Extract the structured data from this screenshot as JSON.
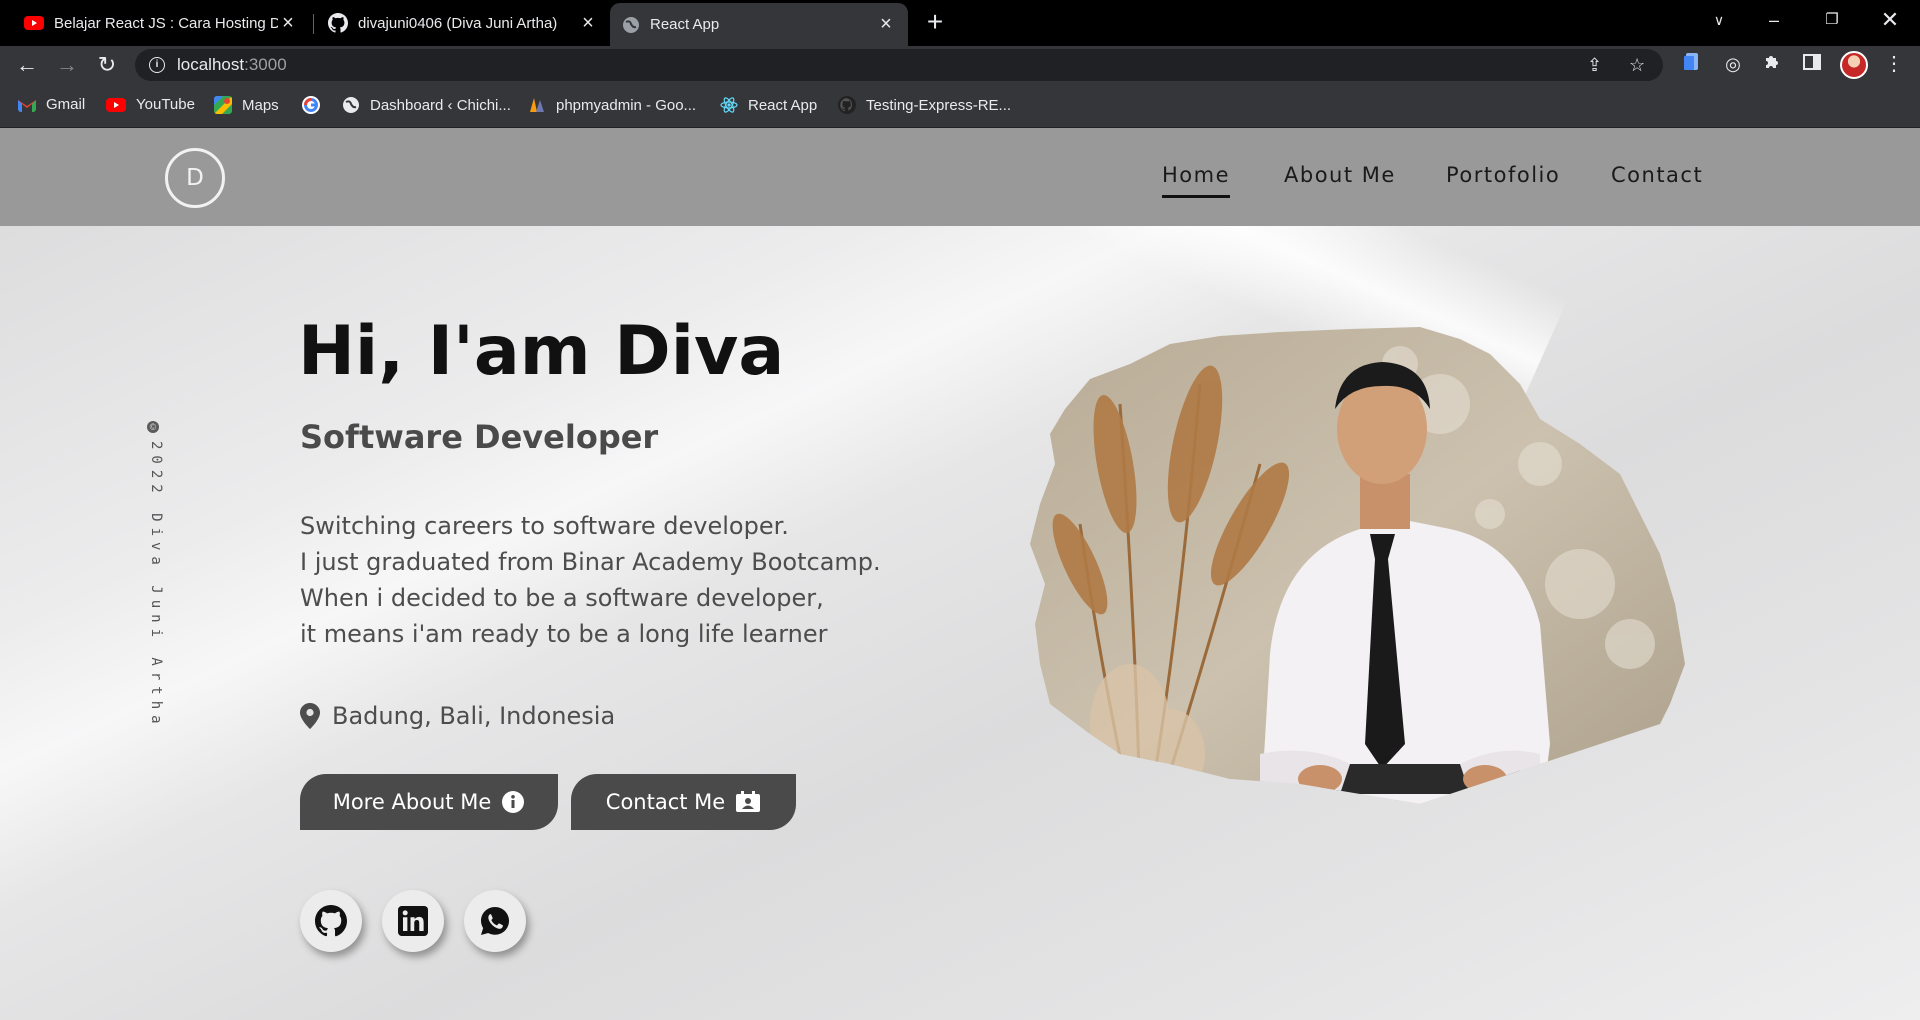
{
  "browser": {
    "tabs": [
      {
        "title": "Belajar React JS : Cara Hosting De",
        "icon": "youtube-icon",
        "active": false
      },
      {
        "title": "divajuni0406 (Diva Juni Artha)",
        "icon": "github-icon",
        "active": false
      },
      {
        "title": "React App",
        "icon": "globe-icon",
        "active": true
      }
    ],
    "address": {
      "host": "localhost",
      "port": ":3000"
    },
    "bookmarks": [
      {
        "label": "Gmail",
        "icon": "gmail-icon"
      },
      {
        "label": "YouTube",
        "icon": "youtube-icon"
      },
      {
        "label": "Maps",
        "icon": "maps-icon"
      },
      {
        "label": "",
        "icon": "google-icon"
      },
      {
        "label": "Dashboard ‹ Chichi...",
        "icon": "globe-icon"
      },
      {
        "label": "phpmyadmin - Goo...",
        "icon": "phpmyadmin-icon"
      },
      {
        "label": "React App",
        "icon": "react-icon"
      },
      {
        "label": "Testing-Express-RE...",
        "icon": "github-icon"
      }
    ]
  },
  "site": {
    "logo": "D",
    "nav": [
      {
        "label": "Home",
        "active": true
      },
      {
        "label": "About Me",
        "active": false
      },
      {
        "label": "Portofolio",
        "active": false
      },
      {
        "label": "Contact",
        "active": false
      }
    ],
    "copyright": "2022 Diva Juni Artha",
    "hero": {
      "title": "Hi, I'am Diva",
      "subtitle": "Software Developer",
      "bio": [
        "Switching careers to software developer.",
        "I just graduated from Binar Academy Bootcamp.",
        "When i decided to be a software developer,",
        "it means i'am ready to be a long life learner"
      ],
      "location": "Badung, Bali, Indonesia",
      "buttons": {
        "about": "More About Me",
        "contact": "Contact Me"
      }
    },
    "social": [
      "github-icon",
      "linkedin-icon",
      "whatsapp-icon"
    ]
  }
}
